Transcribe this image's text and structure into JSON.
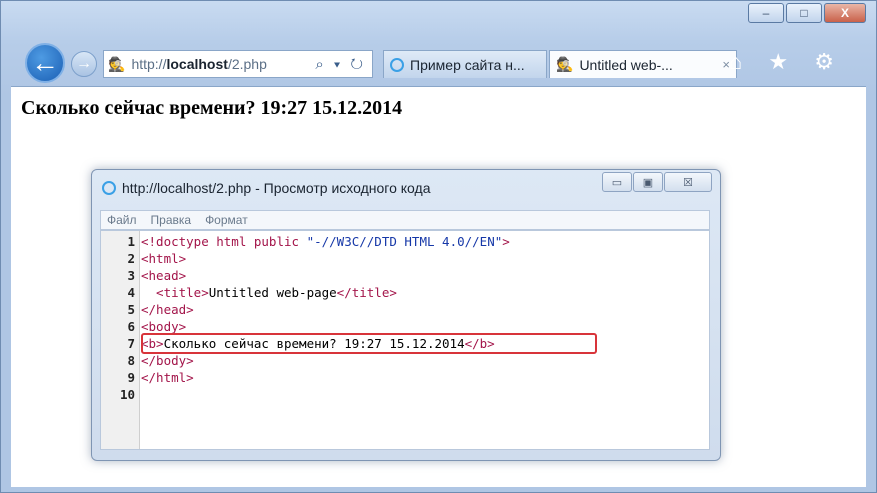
{
  "window": {
    "minimize": "–",
    "maximize": "□",
    "close": "X"
  },
  "nav": {
    "back_icon": "←",
    "forward_icon": "→",
    "address_prefix": "http://",
    "address_host": "localhost",
    "address_path": "/2.php",
    "address_icons": "⌕ ▾ ↻",
    "tabs": [
      {
        "label": "Пример сайта н..."
      },
      {
        "label": "Untitled web-...",
        "close": "×"
      }
    ],
    "right_icons": "⌂ ★ ⚙"
  },
  "page": {
    "heading": "Сколько сейчас времени? 19:27 15.12.2014"
  },
  "source_dialog": {
    "title": "http://localhost/2.php - Просмотр исходного кода",
    "buttons": {
      "minimize": "▭",
      "maximize": "▣",
      "close": "☒"
    },
    "menu": [
      "Файл",
      "Правка",
      "Формат"
    ],
    "lines": [
      {
        "n": "1",
        "a": "<!doctype html public ",
        "b": "\"-//W3C//DTD HTML 4.0//EN\"",
        "c": ">"
      },
      {
        "n": "2",
        "a": "<html>",
        "b": "",
        "c": ""
      },
      {
        "n": "3",
        "a": "<head>",
        "b": "",
        "c": ""
      },
      {
        "n": "4",
        "a": "  <title>",
        "b": "Untitled web-page",
        "c": "</title>"
      },
      {
        "n": "5",
        "a": "</head>",
        "b": "",
        "c": ""
      },
      {
        "n": "6",
        "a": "<body>",
        "b": "",
        "c": ""
      },
      {
        "n": "7",
        "a": "<b>",
        "b": "Сколько сейчас времени? 19:27 15.12.2014",
        "c": "</b>"
      },
      {
        "n": "8",
        "a": "</body>",
        "b": "",
        "c": ""
      },
      {
        "n": "9",
        "a": "</html>",
        "b": "",
        "c": ""
      },
      {
        "n": "10",
        "a": "",
        "b": "",
        "c": ""
      }
    ]
  },
  "colors": {
    "tag": "#a3154a",
    "string": "#1638a8",
    "highlight": "#d8343a"
  }
}
